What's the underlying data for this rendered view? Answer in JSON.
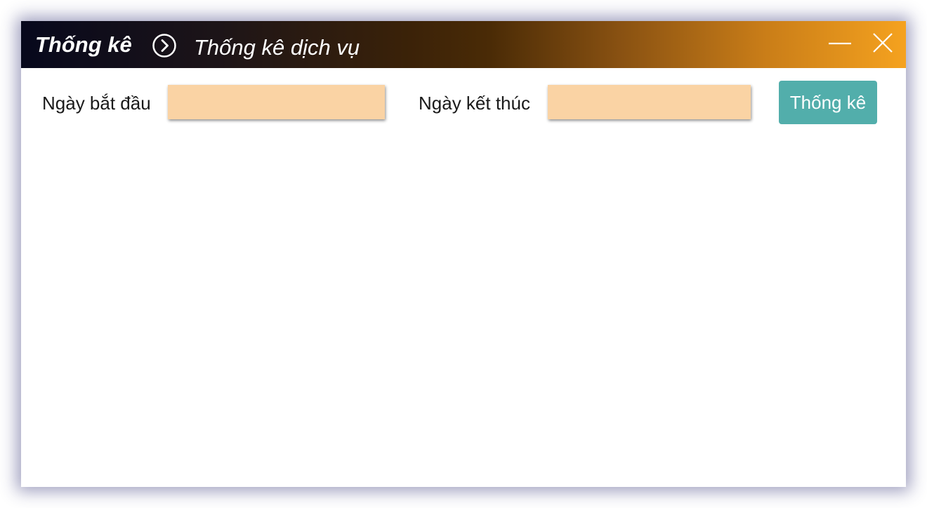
{
  "window": {
    "title": "Thống kê",
    "subtitle": "Thống kê dịch vụ"
  },
  "controls": {
    "minimize_icon": "minimize-icon",
    "close_icon": "close-icon",
    "nav_icon": "chevron-right-circle-icon"
  },
  "filters": {
    "start_label": "Ngày bắt đầu",
    "start_value": "",
    "end_label": "Ngày kết thúc",
    "end_value": "",
    "submit_label": "Thống kê"
  },
  "colors": {
    "titlebar_start": "#07081c",
    "titlebar_end": "#f5a21f",
    "input_background": "#fad3a4",
    "button_background": "#52aeab"
  }
}
